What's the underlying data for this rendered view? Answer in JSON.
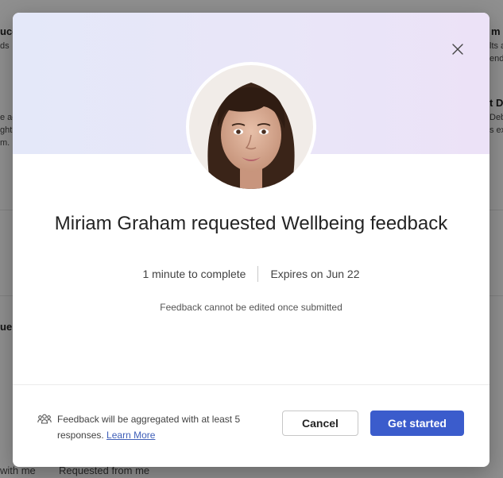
{
  "background": {
    "left_fragments": [
      "uco",
      "ds",
      "e ac",
      "ght",
      "m."
    ],
    "right_fragments": [
      "m",
      "lts a",
      "end",
      "t D",
      "Deb",
      "s ex"
    ],
    "mid_left_fragment": "ue",
    "bottom_tabs": [
      "with me",
      "Requested from me"
    ]
  },
  "modal": {
    "close_icon": "close-icon",
    "avatar_alt": "Miriam Graham",
    "title": "Miriam Graham requested Wellbeing feedback",
    "duration": "1 minute to complete",
    "expires": "Expires on Jun 22",
    "note": "Feedback cannot be edited once submitted",
    "aggregation_text": "Feedback will be aggregated with at least 5 responses.",
    "learn_more": "Learn More",
    "cancel_label": "Cancel",
    "start_label": "Get started",
    "colors": {
      "primary": "#3b5ccc",
      "link": "#3f5fb8",
      "banner_start": "#e4e8f9",
      "banner_end": "#ece2f7"
    }
  }
}
